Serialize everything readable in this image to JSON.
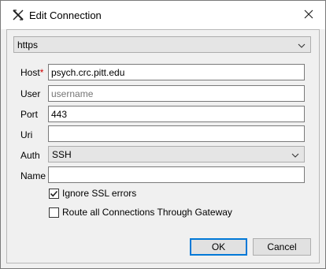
{
  "window": {
    "title": "Edit Connection",
    "app_icon": "x-logo-icon",
    "close_icon": "close-icon"
  },
  "protocol": {
    "selected": "https",
    "chevron_icon": "chevron-down-icon"
  },
  "form": {
    "host": {
      "label": "Host",
      "required_mark": "*",
      "value": "psych.crc.pitt.edu"
    },
    "user": {
      "label": "User",
      "value": "",
      "placeholder": "username"
    },
    "port": {
      "label": "Port",
      "value": "443"
    },
    "uri": {
      "label": "Uri",
      "value": ""
    },
    "auth": {
      "label": "Auth",
      "selected": "SSH"
    },
    "name": {
      "label": "Name",
      "value": ""
    }
  },
  "options": {
    "ignore_ssl": {
      "label": "Ignore SSL errors",
      "checked": true
    },
    "route_gateway": {
      "label": "Route all Connections Through Gateway",
      "checked": false
    }
  },
  "buttons": {
    "ok": "OK",
    "cancel": "Cancel"
  },
  "colors": {
    "accent": "#0078d7",
    "required": "#d00000",
    "placeholder": "#8c8c8c"
  }
}
